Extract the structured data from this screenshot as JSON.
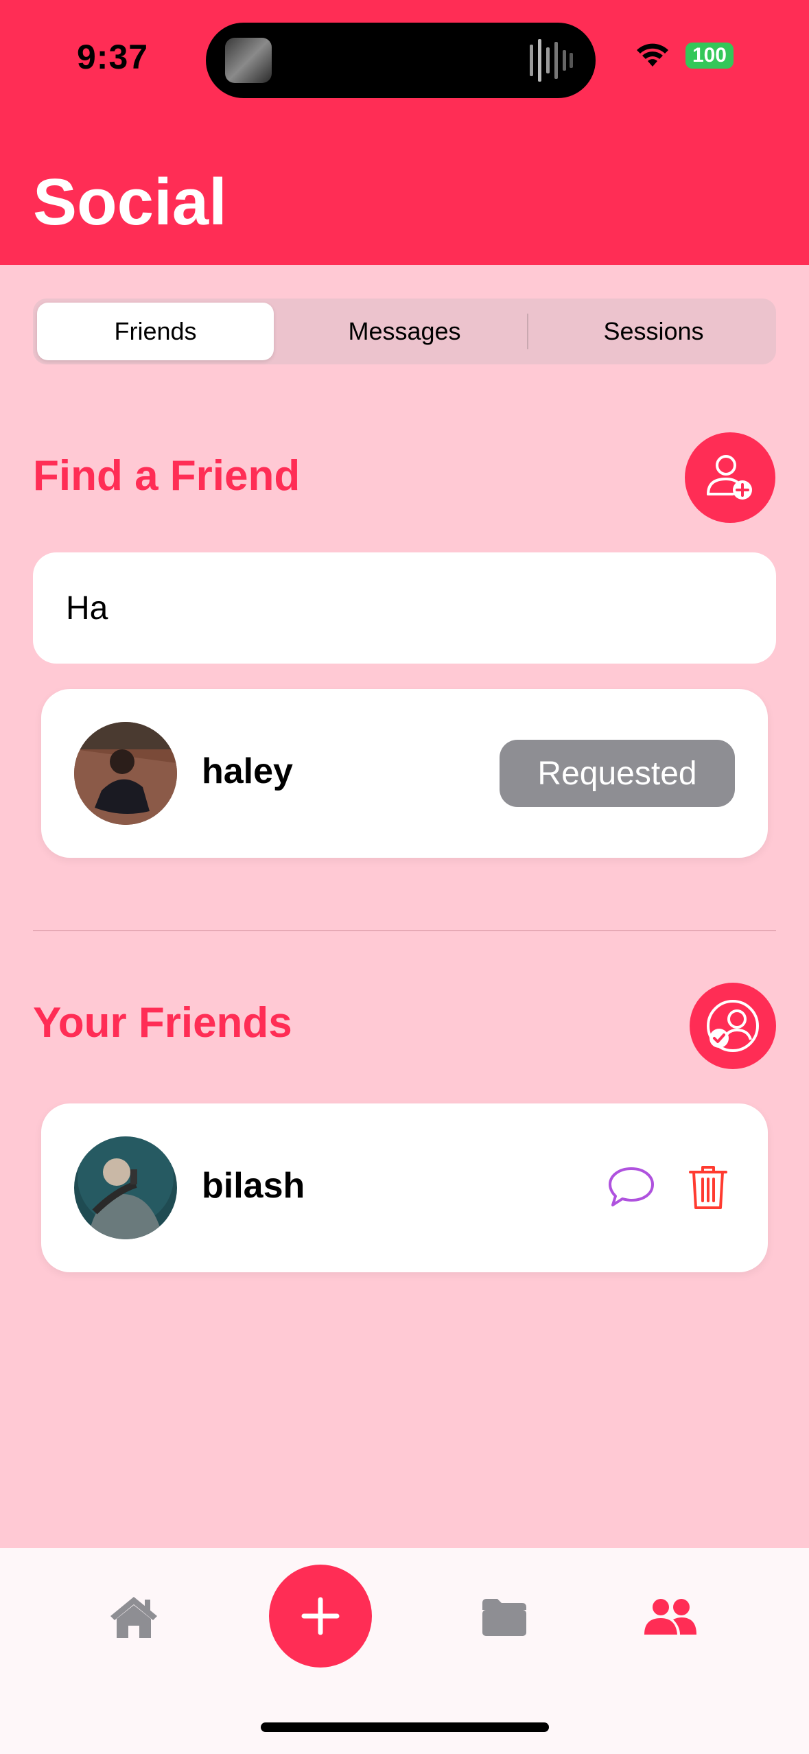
{
  "status_bar": {
    "time": "9:37",
    "battery": "100"
  },
  "header": {
    "title": "Social"
  },
  "tabs": [
    {
      "label": "Friends",
      "active": true
    },
    {
      "label": "Messages",
      "active": false
    },
    {
      "label": "Sessions",
      "active": false
    }
  ],
  "find_friend": {
    "title": "Find a Friend",
    "search_value": "Ha",
    "results": [
      {
        "name": "haley",
        "action_label": "Requested"
      }
    ]
  },
  "your_friends": {
    "title": "Your Friends",
    "items": [
      {
        "name": "bilash"
      }
    ]
  },
  "colors": {
    "accent": "#FF2D55",
    "background": "#FFC9D4",
    "requested": "#8E8E93",
    "message_icon": "#AF52DE",
    "delete_icon": "#FF3B30",
    "tab_inactive": "#8E8E93"
  },
  "tab_bar": {
    "items": [
      {
        "icon": "home-icon",
        "active": false
      },
      {
        "icon": "plus-icon",
        "active": false
      },
      {
        "icon": "folder-icon",
        "active": false
      },
      {
        "icon": "people-icon",
        "active": true
      }
    ]
  }
}
